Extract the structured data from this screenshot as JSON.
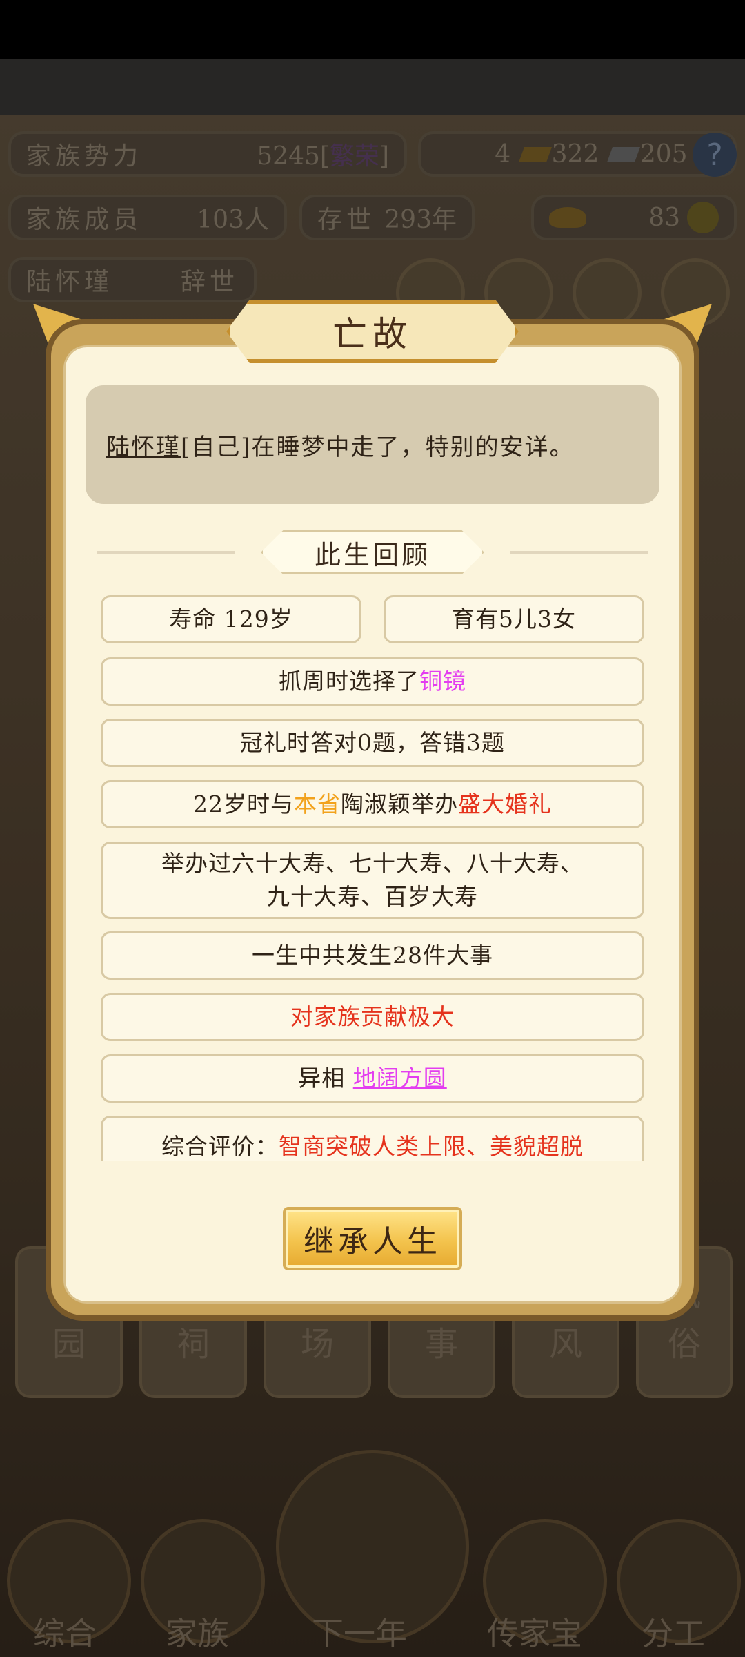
{
  "hud": {
    "power_label": "家族势力",
    "power_value": "5245",
    "power_suffix": "[",
    "power_rank": "繁荣",
    "power_close": "]",
    "res_a": "4",
    "res_b": "322",
    "res_c": "205",
    "help": "?",
    "members_label": "家族成员",
    "members_value": "103人",
    "age_label": "存世",
    "age_value": "293年",
    "gold_value": "83",
    "person_name": "陆怀瑾",
    "person_status": "辞世"
  },
  "tiles": [
    "家\n园",
    "宗\n祠",
    "市\n场",
    "大\n事",
    "家\n风",
    "风\n俗"
  ],
  "nav": [
    "综合",
    "家族",
    "下一年",
    "传家宝",
    "分工"
  ],
  "modal": {
    "title": "亡故",
    "message_name": "陆怀瑾",
    "message_rest": "[自己]在睡梦中走了，特别的安详。",
    "section_title": "此生回顾",
    "lifespan": "寿命 129岁",
    "children": "育有5儿3女",
    "zhuazhou_prefix": "抓周时选择了",
    "zhuazhou_item": "铜镜",
    "guanli": "冠礼时答对0题，答错3题",
    "marriage_prefix": "22岁时与",
    "marriage_origin": "本省",
    "marriage_mid": "陶淑颖举办",
    "marriage_type": "盛大婚礼",
    "birthdays_line1": "举办过六十大寿、七十大寿、八十大寿、",
    "birthdays_line2": "九十大寿、百岁大寿",
    "events": "一生中共发生28件大事",
    "contribution": "对家族贡献极大",
    "omen_prefix": "异相",
    "omen_value": "地阔方圆",
    "eval_prefix": "综合评价：",
    "eval_a": "智商突破人类上限",
    "eval_sep": "、",
    "eval_b": "美貌超脱",
    "button": "继承人生"
  }
}
